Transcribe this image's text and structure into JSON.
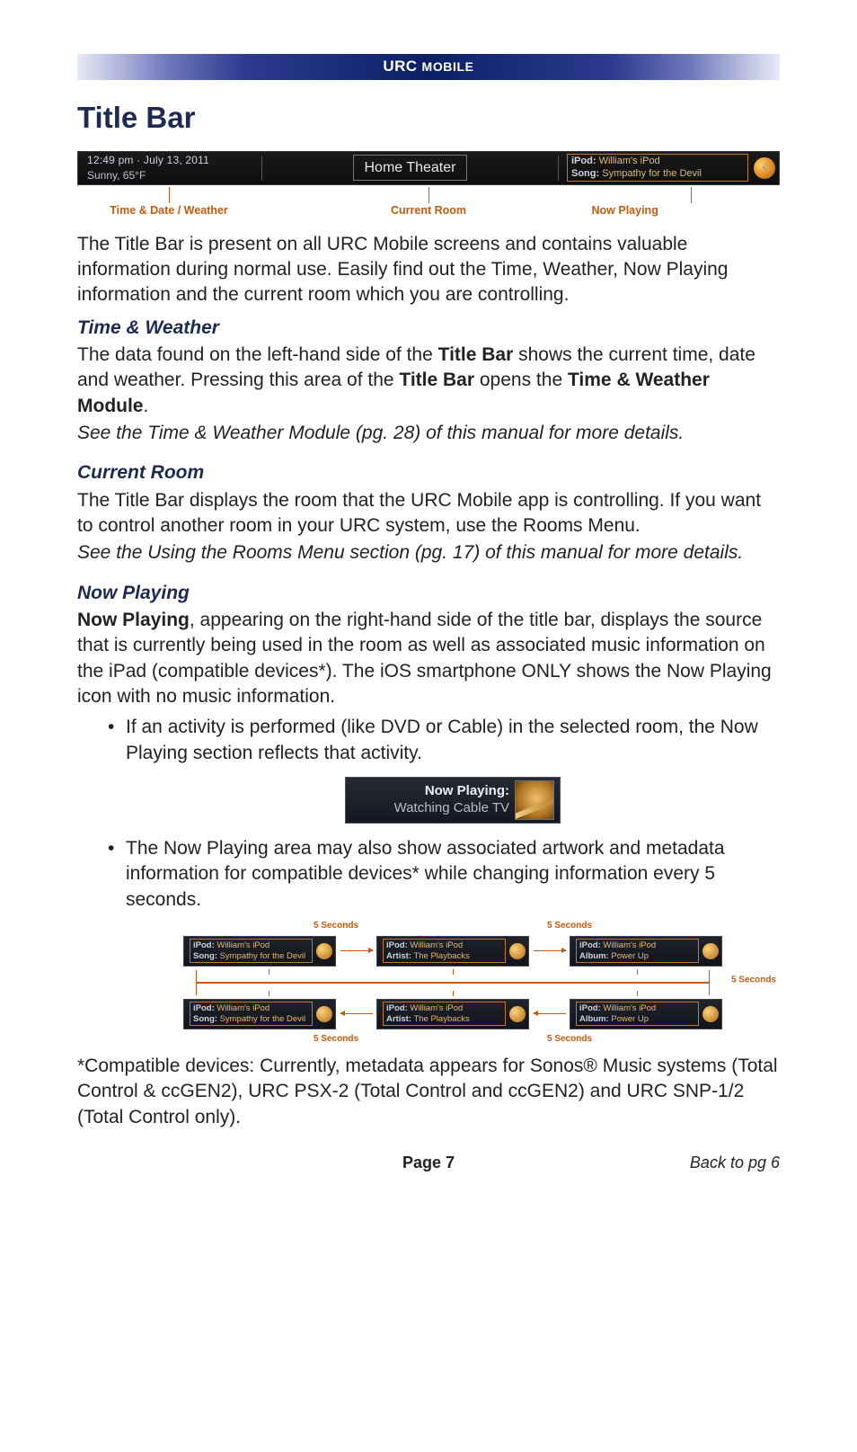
{
  "header_band": "URC MOBILE",
  "page_title": "Title Bar",
  "titlebar": {
    "time_date": "12:49 pm · July 13, 2011",
    "weather": "Sunny, 65°F",
    "room": "Home Theater",
    "np_source_label": "iPod:",
    "np_source_value": "William's iPod",
    "np_track_label": "Song:",
    "np_track_value": "Sympathy for the Devil"
  },
  "captions": {
    "left": "Time & Date / Weather",
    "center": "Current Room",
    "right": "Now Playing"
  },
  "intro": "The Title Bar is present on all URC Mobile screens and contains valuable information during normal use. Easily find out the Time, Weather, Now Playing information and the current room which you are controlling.",
  "sections": {
    "time_weather": {
      "heading": "Time & Weather",
      "p_pre": "The data found on the left-hand side of the ",
      "p_b1": "Title Bar",
      "p_mid1": " shows the current time, date and weather. Pressing this area of the ",
      "p_b2": "Title Bar",
      "p_mid2": " opens the ",
      "p_b3": "Time & Weather Module",
      "p_post": ".",
      "note": "See the Time & Weather Module (pg. 28) of this manual for more details."
    },
    "current_room": {
      "heading": "Current Room",
      "p": "The Title Bar displays the room that the URC Mobile app is controlling.  If you want to control another room in your URC system, use the Rooms Menu.",
      "note": "See the Using the Rooms Menu section (pg. 17) of this manual for more details."
    },
    "now_playing": {
      "heading": "Now Playing",
      "p_b1": "Now Playing",
      "p_mid": ", appearing on the right-hand side of the title bar, displays the source that is currently being used in the room as well as associated music information on the iPad (compatible devices*). The iOS smartphone ONLY shows the Now Playing icon with no music information.",
      "bullets": {
        "b1": "If an activity is performed (like DVD or Cable) in the selected room, the Now Playing section reflects that activity.",
        "b2_pre": "The Now Playing area may also show ",
        "b2_b1": "associated artwork",
        "b2_mid1": " and ",
        "b2_b2": "metadata information",
        "b2_post": " for compatible devices* while changing information every 5 seconds."
      }
    }
  },
  "np_activity_box": {
    "line1": "Now Playing:",
    "line2": "Watching Cable TV"
  },
  "cycle": {
    "interval_label": "5 Seconds",
    "cards": [
      {
        "source_label": "iPod:",
        "source_value": "William's iPod",
        "meta_label": "Song:",
        "meta_value": "Sympathy for the Devil"
      },
      {
        "source_label": "iPod:",
        "source_value": "William's iPod",
        "meta_label": "Artist:",
        "meta_value": "The Playbacks"
      },
      {
        "source_label": "iPod:",
        "source_value": "William's iPod",
        "meta_label": "Album:",
        "meta_value": "Power Up"
      },
      {
        "source_label": "iPod:",
        "source_value": "William's iPod",
        "meta_label": "Song:",
        "meta_value": "Sympathy for the Devil"
      },
      {
        "source_label": "iPod:",
        "source_value": "William's iPod",
        "meta_label": "Artist:",
        "meta_value": "The Playbacks"
      },
      {
        "source_label": "iPod:",
        "source_value": "William's iPod",
        "meta_label": "Album:",
        "meta_value": "Power Up"
      }
    ]
  },
  "compat_footnote": "*Compatible devices: Currently, metadata appears for Sonos® Music systems (Total Control & ccGEN2), URC PSX-2 (Total Control and ccGEN2) and URC SNP-1/2 (Total Control only).",
  "footer": {
    "page": "Page 7",
    "back": "Back to pg 6"
  }
}
